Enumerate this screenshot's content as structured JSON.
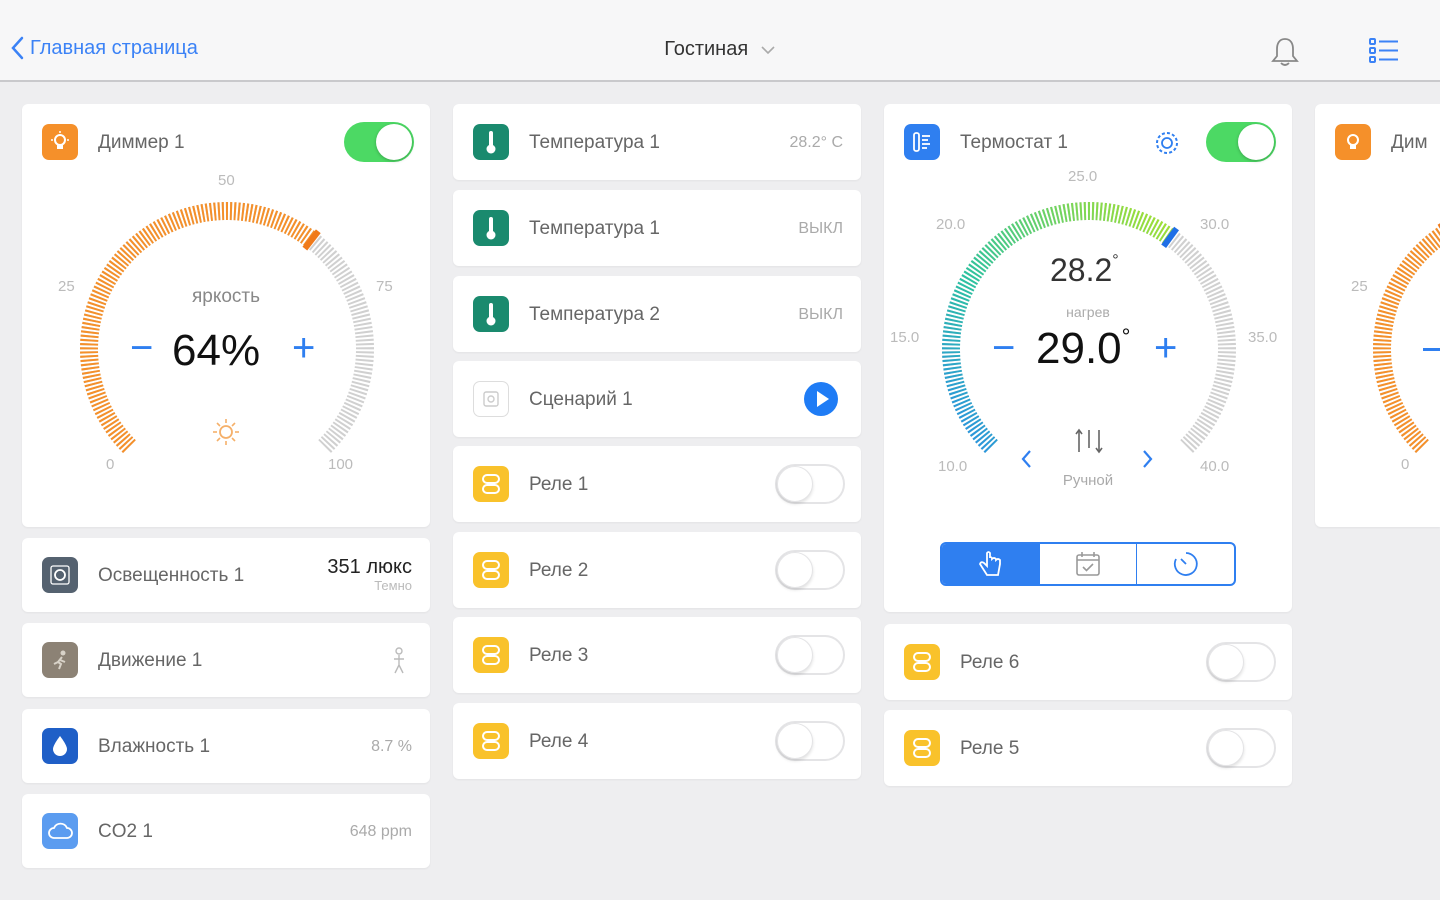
{
  "nav": {
    "back_label": "Главная страница",
    "room_title": "Гостиная"
  },
  "colors": {
    "accent": "#2f7ff0",
    "toggle_on": "#4cd964",
    "dimmer_orange": "#f5902a",
    "relay_yellow": "#f9c22b",
    "temp_teal": "#1a8a6e"
  },
  "dimmer": {
    "name": "Диммер 1",
    "caption": "яркость",
    "value": "64%",
    "level": 64,
    "scale": {
      "min": "0",
      "q1": "25",
      "mid": "50",
      "q3": "75",
      "max": "100"
    },
    "minus": "−",
    "plus": "+"
  },
  "illuminance": {
    "name": "Освещенность 1",
    "value": "351 люкс",
    "status": "Темно"
  },
  "motion": {
    "name": "Движение 1"
  },
  "humidity": {
    "name": "Влажность 1",
    "value": "8.7 %"
  },
  "co2": {
    "name": "CO2 1",
    "value": "648 ppm"
  },
  "sensors": [
    {
      "name": "Температура 1",
      "value": "28.2° C"
    },
    {
      "name": "Температура 1",
      "value": "ВЫКЛ"
    },
    {
      "name": "Температура 2",
      "value": "ВЫКЛ"
    }
  ],
  "scenario": {
    "name": "Сценарий 1"
  },
  "relays_col2": [
    {
      "name": "Реле 1"
    },
    {
      "name": "Реле 2"
    },
    {
      "name": "Реле 3"
    },
    {
      "name": "Реле 4"
    }
  ],
  "thermostat": {
    "name": "Термостат 1",
    "current": "28.2",
    "mode_text": "нагрев",
    "setpoint": "29.0",
    "degree": "°",
    "minus": "−",
    "plus": "+",
    "scale": {
      "t10": "10.0",
      "t15": "15.0",
      "t20": "20.0",
      "t25": "25.0",
      "t30": "30.0",
      "t35": "35.0",
      "t40": "40.0"
    },
    "mode": "Ручной"
  },
  "relays_col3": [
    {
      "name": "Реле 6"
    },
    {
      "name": "Реле 5"
    }
  ],
  "partial_card": {
    "name_fragment": "Дим",
    "scale_q1": "25",
    "scale_min": "0"
  }
}
